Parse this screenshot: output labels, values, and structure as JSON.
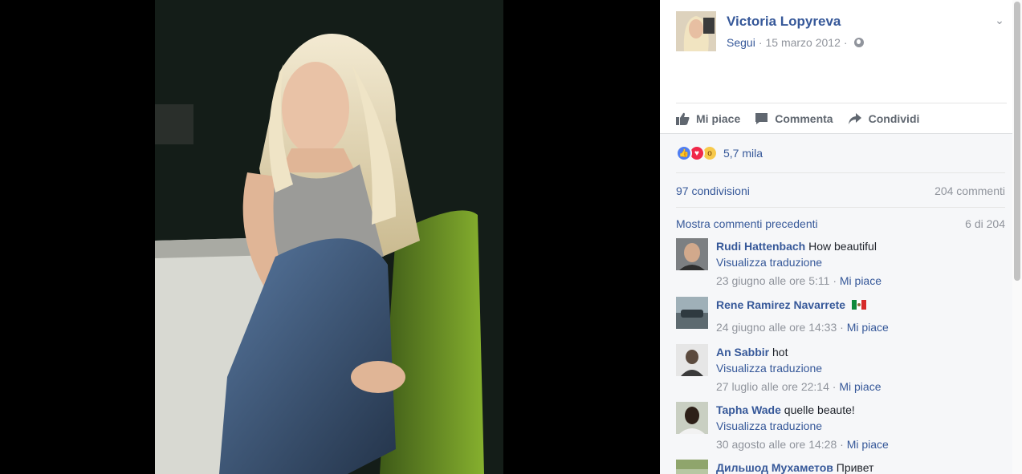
{
  "post": {
    "author": "Victoria Lopyreva",
    "follow_label": "Segui",
    "date": "15 marzo 2012",
    "separator": "·"
  },
  "actions": {
    "like": "Mi piace",
    "comment": "Commenta",
    "share": "Condividi"
  },
  "reactions": {
    "count": "5,7 mila",
    "types": [
      "like",
      "love",
      "wow"
    ]
  },
  "stats": {
    "shares": "97 condivisioni",
    "comments": "204 commenti"
  },
  "previous": {
    "label": "Mostra commenti precedenti",
    "count": "6 di 204"
  },
  "comments": [
    {
      "name": "Rudi Hattenbach",
      "text": "How beautiful",
      "translate": "Visualizza traduzione",
      "time": "23 giugno alle ore 5:11",
      "like": "Mi piace",
      "flag": false
    },
    {
      "name": "Rene Ramirez Navarrete",
      "text": "",
      "translate": "",
      "time": "24 giugno alle ore 14:33",
      "like": "Mi piace",
      "flag": true
    },
    {
      "name": "An Sabbir",
      "text": "hot",
      "translate": "Visualizza traduzione",
      "time": "27 luglio alle ore 22:14",
      "like": "Mi piace",
      "flag": false
    },
    {
      "name": "Tapha Wade",
      "text": "quelle beaute!",
      "translate": "Visualizza traduzione",
      "time": "30 agosto alle ore 14:28",
      "like": "Mi piace",
      "flag": false
    },
    {
      "name": "Дильшод Мухаметов",
      "text": "Привет",
      "translate": "",
      "time": "",
      "like": "",
      "flag": false
    }
  ],
  "colors": {
    "link": "#365899",
    "muted": "#90949c",
    "panel_gray": "#f6f7f9"
  },
  "icons": [
    "thumbs-up-icon",
    "comment-icon",
    "share-arrow-icon",
    "globe-icon",
    "chevron-down-icon"
  ]
}
